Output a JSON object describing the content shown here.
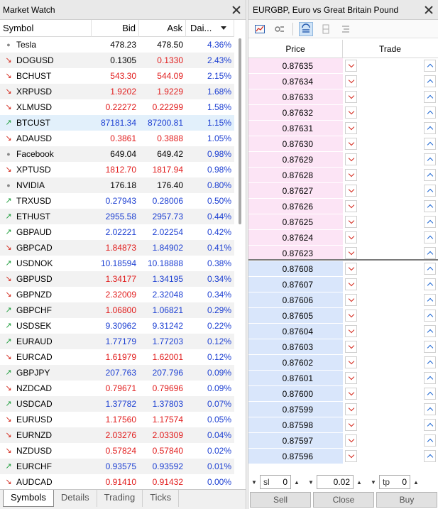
{
  "market_watch": {
    "title": "Market Watch",
    "columns": {
      "symbol": "Symbol",
      "bid": "Bid",
      "ask": "Ask",
      "daily": "Dai..."
    },
    "rows": [
      {
        "trend": "flat",
        "symbol": "Tesla",
        "bid": "478.23",
        "ask": "478.50",
        "change": "4.36%",
        "bid_dir": "flat",
        "ask_dir": "flat"
      },
      {
        "trend": "down",
        "symbol": "DOGUSD",
        "bid": "0.1305",
        "ask": "0.1330",
        "change": "2.43%",
        "bid_dir": "flat",
        "ask_dir": "down"
      },
      {
        "trend": "down",
        "symbol": "BCHUST",
        "bid": "543.30",
        "ask": "544.09",
        "change": "2.15%",
        "bid_dir": "down",
        "ask_dir": "down"
      },
      {
        "trend": "down",
        "symbol": "XRPUSD",
        "bid": "1.9202",
        "ask": "1.9229",
        "change": "1.68%",
        "bid_dir": "down",
        "ask_dir": "down"
      },
      {
        "trend": "down",
        "symbol": "XLMUSD",
        "bid": "0.22272",
        "ask": "0.22299",
        "change": "1.58%",
        "bid_dir": "down",
        "ask_dir": "down"
      },
      {
        "trend": "up",
        "symbol": "BTCUST",
        "bid": "87181.34",
        "ask": "87200.81",
        "change": "1.15%",
        "bid_dir": "up",
        "ask_dir": "up"
      },
      {
        "trend": "down",
        "symbol": "ADAUSD",
        "bid": "0.3861",
        "ask": "0.3888",
        "change": "1.05%",
        "bid_dir": "down",
        "ask_dir": "down"
      },
      {
        "trend": "flat",
        "symbol": "Facebook",
        "bid": "649.04",
        "ask": "649.42",
        "change": "0.98%",
        "bid_dir": "flat",
        "ask_dir": "flat"
      },
      {
        "trend": "down",
        "symbol": "XPTUSD",
        "bid": "1812.70",
        "ask": "1817.94",
        "change": "0.98%",
        "bid_dir": "down",
        "ask_dir": "down"
      },
      {
        "trend": "flat",
        "symbol": "NVIDIA",
        "bid": "176.18",
        "ask": "176.40",
        "change": "0.80%",
        "bid_dir": "flat",
        "ask_dir": "flat"
      },
      {
        "trend": "up",
        "symbol": "TRXUSD",
        "bid": "0.27943",
        "ask": "0.28006",
        "change": "0.50%",
        "bid_dir": "up",
        "ask_dir": "up"
      },
      {
        "trend": "up",
        "symbol": "ETHUST",
        "bid": "2955.58",
        "ask": "2957.73",
        "change": "0.44%",
        "bid_dir": "up",
        "ask_dir": "up"
      },
      {
        "trend": "up",
        "symbol": "GBPAUD",
        "bid": "2.02221",
        "ask": "2.02254",
        "change": "0.42%",
        "bid_dir": "up",
        "ask_dir": "up"
      },
      {
        "trend": "down",
        "symbol": "GBPCAD",
        "bid": "1.84873",
        "ask": "1.84902",
        "change": "0.41%",
        "bid_dir": "down",
        "ask_dir": "up"
      },
      {
        "trend": "up",
        "symbol": "USDNOK",
        "bid": "10.18594",
        "ask": "10.18888",
        "change": "0.38%",
        "bid_dir": "up",
        "ask_dir": "up"
      },
      {
        "trend": "down",
        "symbol": "GBPUSD",
        "bid": "1.34177",
        "ask": "1.34195",
        "change": "0.34%",
        "bid_dir": "down",
        "ask_dir": "up"
      },
      {
        "trend": "down",
        "symbol": "GBPNZD",
        "bid": "2.32009",
        "ask": "2.32048",
        "change": "0.34%",
        "bid_dir": "down",
        "ask_dir": "up"
      },
      {
        "trend": "up",
        "symbol": "GBPCHF",
        "bid": "1.06800",
        "ask": "1.06821",
        "change": "0.29%",
        "bid_dir": "down",
        "ask_dir": "up"
      },
      {
        "trend": "up",
        "symbol": "USDSEK",
        "bid": "9.30962",
        "ask": "9.31242",
        "change": "0.22%",
        "bid_dir": "up",
        "ask_dir": "up"
      },
      {
        "trend": "up",
        "symbol": "EURAUD",
        "bid": "1.77179",
        "ask": "1.77203",
        "change": "0.12%",
        "bid_dir": "up",
        "ask_dir": "up"
      },
      {
        "trend": "down",
        "symbol": "EURCAD",
        "bid": "1.61979",
        "ask": "1.62001",
        "change": "0.12%",
        "bid_dir": "down",
        "ask_dir": "down"
      },
      {
        "trend": "up",
        "symbol": "GBPJPY",
        "bid": "207.763",
        "ask": "207.796",
        "change": "0.09%",
        "bid_dir": "up",
        "ask_dir": "up"
      },
      {
        "trend": "down",
        "symbol": "NZDCAD",
        "bid": "0.79671",
        "ask": "0.79696",
        "change": "0.09%",
        "bid_dir": "down",
        "ask_dir": "down"
      },
      {
        "trend": "up",
        "symbol": "USDCAD",
        "bid": "1.37782",
        "ask": "1.37803",
        "change": "0.07%",
        "bid_dir": "up",
        "ask_dir": "up"
      },
      {
        "trend": "down",
        "symbol": "EURUSD",
        "bid": "1.17560",
        "ask": "1.17574",
        "change": "0.05%",
        "bid_dir": "down",
        "ask_dir": "down"
      },
      {
        "trend": "down",
        "symbol": "EURNZD",
        "bid": "2.03276",
        "ask": "2.03309",
        "change": "0.04%",
        "bid_dir": "down",
        "ask_dir": "down"
      },
      {
        "trend": "down",
        "symbol": "NZDUSD",
        "bid": "0.57824",
        "ask": "0.57840",
        "change": "0.02%",
        "bid_dir": "down",
        "ask_dir": "down"
      },
      {
        "trend": "up",
        "symbol": "EURCHF",
        "bid": "0.93575",
        "ask": "0.93592",
        "change": "0.01%",
        "bid_dir": "up",
        "ask_dir": "up"
      },
      {
        "trend": "down",
        "symbol": "AUDCAD",
        "bid": "0.91410",
        "ask": "0.91432",
        "change": "0.00%",
        "bid_dir": "down",
        "ask_dir": "down"
      }
    ],
    "selected_row_index": 5,
    "tabs": [
      "Symbols",
      "Details",
      "Trading",
      "Ticks"
    ],
    "active_tab": 0
  },
  "depth_of_market": {
    "title": "EURGBP, Euro vs Great Britain Pound",
    "columns": {
      "price": "Price",
      "trade": "Trade"
    },
    "ask_prices": [
      "0.87635",
      "0.87634",
      "0.87633",
      "0.87632",
      "0.87631",
      "0.87630",
      "0.87629",
      "0.87628",
      "0.87627",
      "0.87626",
      "0.87625",
      "0.87624",
      "0.87623"
    ],
    "bid_prices": [
      "0.87608",
      "0.87607",
      "0.87606",
      "0.87605",
      "0.87604",
      "0.87603",
      "0.87602",
      "0.87601",
      "0.87600",
      "0.87599",
      "0.87598",
      "0.87597",
      "0.87596"
    ],
    "controls": {
      "sl_label": "sl",
      "sl_value": "0",
      "volume_value": "0.02",
      "tp_label": "tp",
      "tp_value": "0"
    },
    "buttons": {
      "sell": "Sell",
      "close": "Close",
      "buy": "Buy"
    }
  },
  "colors": {
    "up_arrow": "#1e9e3c",
    "down_arrow": "#d42a1e",
    "price_up": "#1c3fd2",
    "price_down": "#e11b1b",
    "ask_bg": "#fce4f5",
    "bid_bg": "#d9e6fb"
  }
}
